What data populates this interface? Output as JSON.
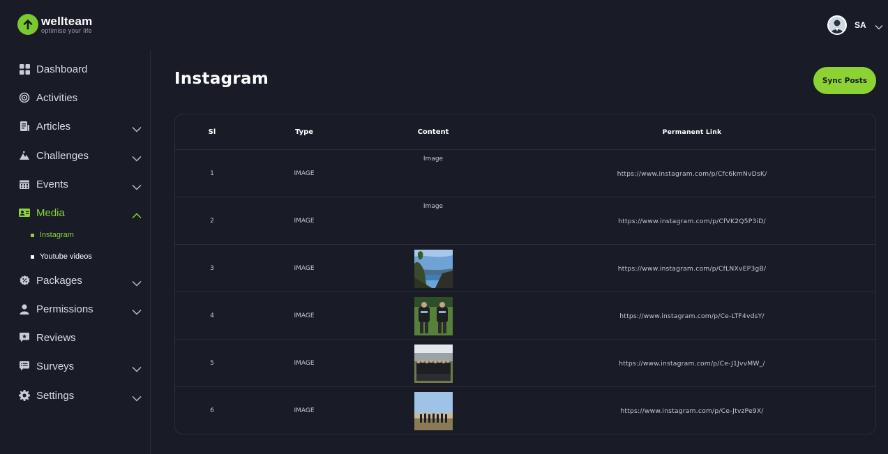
{
  "brand": {
    "name": "wellteam",
    "tagline": "optimise your life"
  },
  "user": {
    "initials": "SA"
  },
  "sidebar": {
    "items": [
      {
        "label": "Dashboard",
        "icon": "dashboard-icon",
        "has_chevron": false
      },
      {
        "label": "Activities",
        "icon": "target-icon",
        "has_chevron": false
      },
      {
        "label": "Articles",
        "icon": "article-icon",
        "has_chevron": true
      },
      {
        "label": "Challenges",
        "icon": "mountain-icon",
        "has_chevron": true
      },
      {
        "label": "Events",
        "icon": "calendar-icon",
        "has_chevron": true
      },
      {
        "label": "Media",
        "icon": "media-icon",
        "has_chevron": true,
        "active": true,
        "expanded": true
      },
      {
        "label": "Packages",
        "icon": "package-icon",
        "has_chevron": true
      },
      {
        "label": "Permissions",
        "icon": "user-icon",
        "has_chevron": true
      },
      {
        "label": "Reviews",
        "icon": "review-icon",
        "has_chevron": false
      },
      {
        "label": "Surveys",
        "icon": "survey-icon",
        "has_chevron": true
      },
      {
        "label": "Settings",
        "icon": "gear-icon",
        "has_chevron": true
      }
    ],
    "media_sub": [
      {
        "label": "Instagram",
        "active": true
      },
      {
        "label": "Youtube videos",
        "active": false
      }
    ]
  },
  "page": {
    "title": "Instagram",
    "sync_button": "Sync Posts"
  },
  "table": {
    "headers": [
      "Sl",
      "Type",
      "Content",
      "Permanent Link"
    ],
    "rows": [
      {
        "sl": "1",
        "type": "IMAGE",
        "content": "Image",
        "link": "https://www.instagram.com/p/Cfc6kmNvDsK/"
      },
      {
        "sl": "2",
        "type": "IMAGE",
        "content": "Image",
        "link": "https://www.instagram.com/p/CfVK2Q5P3iD/"
      },
      {
        "sl": "3",
        "type": "IMAGE",
        "content": "lake-landscape-photo",
        "link": "https://www.instagram.com/p/CfLNXvEP3gB/"
      },
      {
        "sl": "4",
        "type": "IMAGE",
        "content": "two-people-photo",
        "link": "https://www.instagram.com/p/Ce-LTF4vdsY/"
      },
      {
        "sl": "5",
        "type": "IMAGE",
        "content": "group-photo-city",
        "link": "https://www.instagram.com/p/Ce-J1JvvMW_/"
      },
      {
        "sl": "6",
        "type": "IMAGE",
        "content": "group-photo-hilltop",
        "link": "https://www.instagram.com/p/Ce-JtvzPe9X/"
      }
    ]
  },
  "colors": {
    "accent": "#8cd232",
    "background": "#191b26",
    "border": "#2a2d3a"
  }
}
